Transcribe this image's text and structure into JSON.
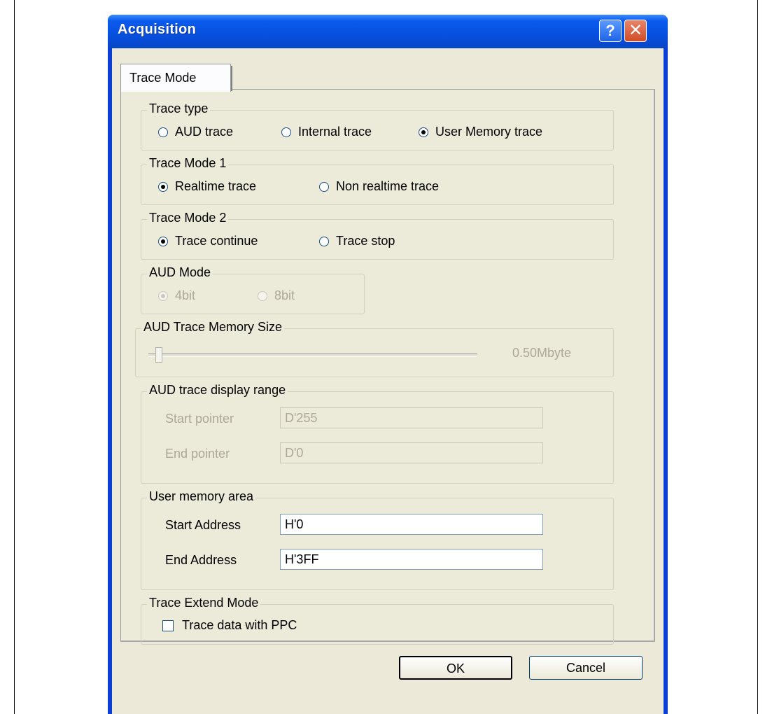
{
  "window": {
    "title": "Acquisition",
    "help_glyph": "?",
    "close_glyph": "✕"
  },
  "tabs": [
    {
      "label": "Trace Mode"
    }
  ],
  "trace_type": {
    "legend": "Trace type",
    "options": [
      "AUD trace",
      "Internal trace",
      "User Memory trace"
    ],
    "selected": "User Memory trace"
  },
  "trace_mode_1": {
    "legend": "Trace Mode 1",
    "options": [
      "Realtime trace",
      "Non realtime trace"
    ],
    "selected": "Realtime trace"
  },
  "trace_mode_2": {
    "legend": "Trace Mode 2",
    "options": [
      "Trace continue",
      "Trace stop"
    ],
    "selected": "Trace continue"
  },
  "aud_mode": {
    "legend": "AUD Mode",
    "options": [
      "4bit",
      "8bit"
    ],
    "selected": "4bit",
    "enabled": false
  },
  "aud_trace_memory_size": {
    "legend": "AUD Trace Memory Size",
    "value_label": "0.50Mbyte",
    "enabled": false
  },
  "aud_trace_display_range": {
    "legend": "AUD trace display range",
    "start_label": "Start pointer",
    "start_value": "D'255",
    "end_label": "End pointer",
    "end_value": "D'0",
    "enabled": false
  },
  "user_memory_area": {
    "legend": "User memory area",
    "start_label": "Start Address",
    "start_value": "H'0",
    "end_label": "End Address",
    "end_value": "H'3FF"
  },
  "trace_extend_mode": {
    "legend": "Trace Extend Mode",
    "checkbox_label": "Trace data with PPC",
    "checked": false
  },
  "buttons": {
    "ok": "OK",
    "cancel": "Cancel"
  }
}
